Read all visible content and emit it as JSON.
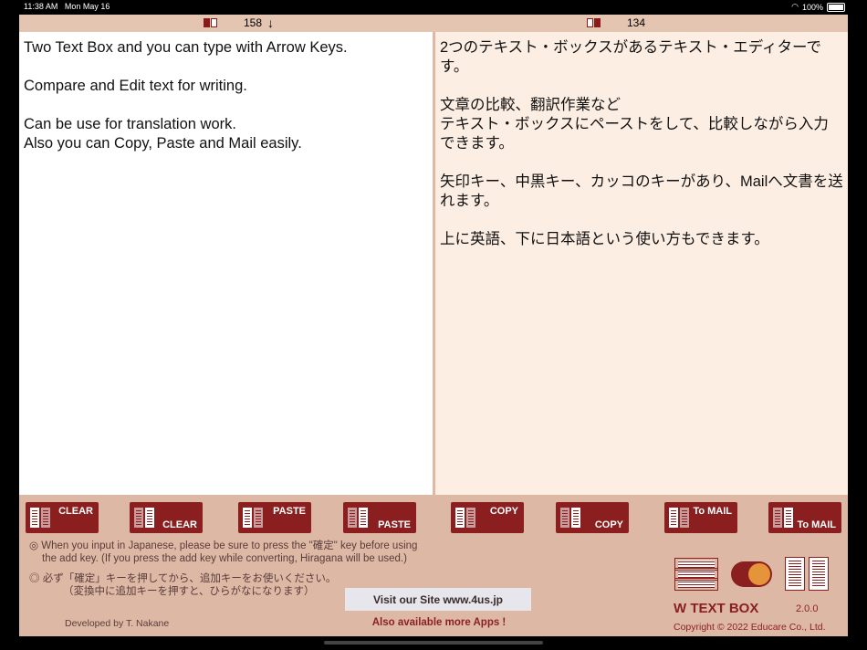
{
  "status": {
    "time": "11:38 AM",
    "date": "Mon May 16",
    "battery": "100%"
  },
  "counters": {
    "left": "158",
    "left_arrow": "↓",
    "right": "134"
  },
  "panes": {
    "left": "Two Text Box and you can type with Arrow Keys.\n\nCompare and Edit text for writing.\n\nCan be use for translation work.\nAlso you can Copy, Paste and Mail easily.",
    "right": "2つのテキスト・ボックスがあるテキスト・エディターです。\n\n文章の比較、翻訳作業など\nテキスト・ボックスにペーストをして、比較しながら入力できます。\n\n矢印キー、中黒キー、カッコのキーがあり、Mailへ文書を送れます。\n\n上に英語、下に日本語という使い方もできます。"
  },
  "buttons": [
    {
      "label": "CLEAR"
    },
    {
      "label": "CLEAR"
    },
    {
      "label": "PASTE"
    },
    {
      "label": "PASTE"
    },
    {
      "label": "COPY"
    },
    {
      "label": "COPY"
    },
    {
      "label": "To MAIL"
    },
    {
      "label": "To MAIL"
    }
  ],
  "notes": {
    "en_line1": "◎  When you input in Japanese, please be sure to press the \"確定\" key before using",
    "en_line2": "the add key. (If you press the add key while converting, Hiragana will be used.)",
    "jp_line1": "◎  必ず「確定」キーを押してから、追加キーをお使いください。",
    "jp_line2": "（変換中に追加キーを押すと、ひらがなになります）"
  },
  "site_button": "Visit our Site www.4us.jp",
  "more_apps": "Also available more Apps !",
  "developer": "Developed by T. Nakane",
  "app_name": "W TEXT BOX",
  "version": "2.0.0",
  "copyright": "Copyright © 2022 Educare Co., Ltd.",
  "colors": {
    "accent": "#8b1f1f",
    "panel": "#ddb9a5",
    "right_pane": "#fdeee4",
    "toggle_knob": "#e5943a"
  }
}
